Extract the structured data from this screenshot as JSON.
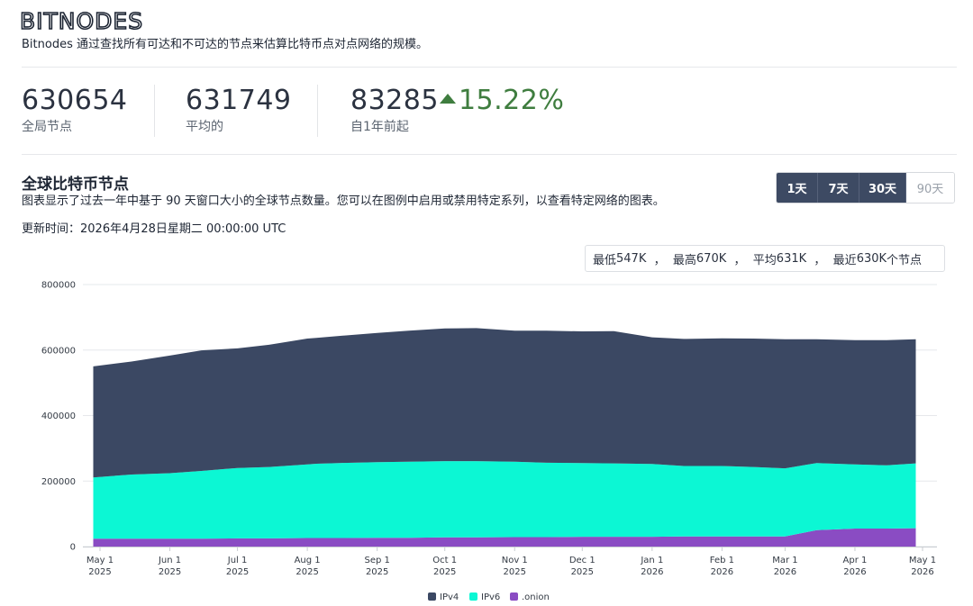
{
  "brand": {
    "logo_text": "BITNODES",
    "tagline": "Bitnodes 通过查找所有可达和不可达的节点来估算比特币点对点网络的规模。"
  },
  "stats": [
    {
      "value": "630654",
      "label": "全局节点"
    },
    {
      "value": "631749",
      "label": "平均的"
    },
    {
      "value": "83285",
      "change": "15.22%",
      "label": "自1年前起"
    }
  ],
  "section": {
    "title": "全球比特币节点",
    "description": "图表显示了过去一年中基于 90 天窗口大小的全球节点数量。您可以在图例中启用或禁用特定系列，以查看特定网络的图表。",
    "updated": "更新时间：2026年4月28日星期二 00:00:00 UTC"
  },
  "range_buttons": [
    {
      "label": "1天",
      "active": true
    },
    {
      "label": "7天",
      "active": true
    },
    {
      "label": "30天",
      "active": true
    },
    {
      "label": "90天",
      "active": false
    }
  ],
  "summary": {
    "min_label": "最低",
    "min": "547K",
    "max_label": "最高",
    "max": "670K",
    "avg_label": "平均",
    "avg": "631K",
    "latest_label": "最近",
    "latest": "630K",
    "unit": "个节点"
  },
  "colors": {
    "ipv4": "#3b4863",
    "ipv6": "#0cf7d4",
    "onion": "#8a4cc3",
    "accent_up": "#3f7d3f",
    "button_active": "#3d4a63"
  },
  "chart_data": {
    "type": "area",
    "stacked": true,
    "ylim": [
      0,
      800000
    ],
    "yticks": [
      "0",
      "200000",
      "400000",
      "600000",
      "800000"
    ],
    "xticks": [
      [
        "May 1",
        "2025"
      ],
      [
        "Jun 1",
        "2025"
      ],
      [
        "Jul 1",
        "2025"
      ],
      [
        "Aug 1",
        "2025"
      ],
      [
        "Sep 1",
        "2025"
      ],
      [
        "Oct 1",
        "2025"
      ],
      [
        "Nov 1",
        "2025"
      ],
      [
        "Dec 1",
        "2025"
      ],
      [
        "Jan 1",
        "2026"
      ],
      [
        "Feb 1",
        "2026"
      ],
      [
        "Mar 1",
        "2026"
      ],
      [
        "Apr 1",
        "2026"
      ],
      [
        "May 1",
        "2026"
      ]
    ],
    "x": [
      "2025-04-28",
      "2025-05-15",
      "2025-06-01",
      "2025-06-15",
      "2025-07-01",
      "2025-07-15",
      "2025-08-01",
      "2025-08-05",
      "2025-08-15",
      "2025-09-01",
      "2025-09-15",
      "2025-10-01",
      "2025-10-15",
      "2025-11-01",
      "2025-11-15",
      "2025-12-01",
      "2025-12-15",
      "2026-01-01",
      "2026-01-15",
      "2026-02-01",
      "2026-02-15",
      "2026-03-01",
      "2026-03-15",
      "2026-04-01",
      "2026-04-15",
      "2026-04-28"
    ],
    "series": [
      {
        "name": ".onion",
        "values": [
          24000,
          24000,
          24000,
          24000,
          25000,
          25000,
          26000,
          26000,
          26000,
          27000,
          27000,
          28000,
          28000,
          29000,
          29000,
          30000,
          30000,
          30000,
          31000,
          31000,
          31000,
          31000,
          50000,
          55000,
          55000,
          56000
        ]
      },
      {
        "name": "IPv6",
        "values": [
          187000,
          196000,
          200000,
          207000,
          215000,
          218000,
          225000,
          227000,
          229000,
          231000,
          232000,
          233000,
          233000,
          230000,
          227000,
          225000,
          224000,
          222000,
          215000,
          215000,
          212000,
          208000,
          205000,
          196000,
          193000,
          198000
        ]
      },
      {
        "name": "IPv4",
        "values": [
          339000,
          345000,
          359000,
          368000,
          365000,
          373000,
          384000,
          384000,
          388000,
          394000,
          400000,
          405000,
          406000,
          400000,
          403000,
          402000,
          404000,
          387000,
          388000,
          390000,
          392000,
          394000,
          378000,
          379000,
          382000,
          379000
        ]
      }
    ],
    "legend": [
      "IPv4",
      "IPv6",
      ".onion"
    ],
    "legend_position": "bottom"
  }
}
